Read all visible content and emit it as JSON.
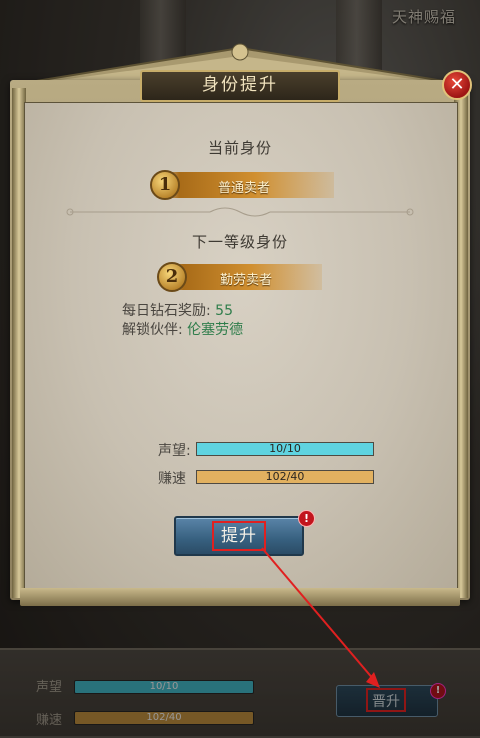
{
  "background": {
    "corner_text": "天神赐福"
  },
  "dialog": {
    "title": "身份提升",
    "close_icon": "close-icon",
    "current_section": {
      "heading": "当前身份",
      "rank_number": "1",
      "rank_name": "普通卖者"
    },
    "next_section": {
      "heading": "下一等级身份",
      "rank_number": "2",
      "rank_name": "勤劳卖者"
    },
    "rewards": {
      "diamond_label": "每日钻石奖励:",
      "diamond_value": "55",
      "partner_label": "解锁伙伴:",
      "partner_value": "伦塞劳德"
    },
    "stats": [
      {
        "label": "声望:",
        "text": "10/10",
        "progress": 1.0,
        "color": "#5fd3e0"
      },
      {
        "label": "赚速",
        "text": "102/40",
        "progress": 1.0,
        "color": "#e2b160"
      }
    ],
    "upgrade_button": "提升",
    "alert_badge": "!"
  },
  "bottom_panel": {
    "stats": [
      {
        "label": "声望",
        "text": "10/10",
        "progress": 1.0,
        "color": "#3cb4c4"
      },
      {
        "label": "赚速",
        "text": "102/40",
        "progress": 1.0,
        "color": "#b98a3a"
      }
    ],
    "upgrade_button": "晋升",
    "alert_badge": "!"
  },
  "colors": {
    "highlight_box": "#e02020",
    "annotation_arrow": "#e02020"
  }
}
